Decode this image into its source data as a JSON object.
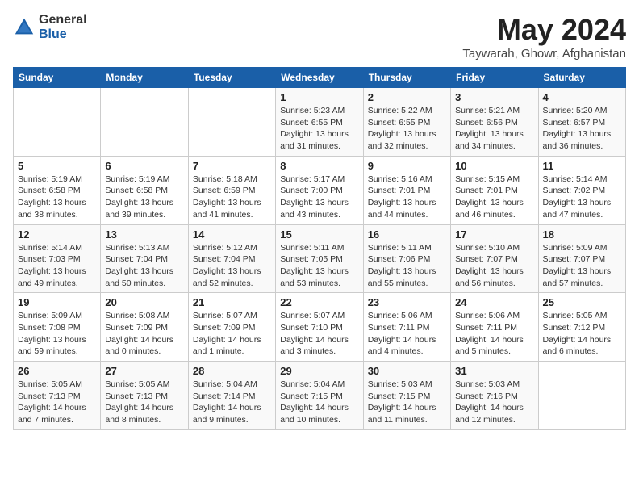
{
  "header": {
    "logo_general": "General",
    "logo_blue": "Blue",
    "month_year": "May 2024",
    "location": "Taywarah, Ghowr, Afghanistan"
  },
  "days_of_week": [
    "Sunday",
    "Monday",
    "Tuesday",
    "Wednesday",
    "Thursday",
    "Friday",
    "Saturday"
  ],
  "weeks": [
    [
      {
        "day": "",
        "info": ""
      },
      {
        "day": "",
        "info": ""
      },
      {
        "day": "",
        "info": ""
      },
      {
        "day": "1",
        "info": "Sunrise: 5:23 AM\nSunset: 6:55 PM\nDaylight: 13 hours\nand 31 minutes."
      },
      {
        "day": "2",
        "info": "Sunrise: 5:22 AM\nSunset: 6:55 PM\nDaylight: 13 hours\nand 32 minutes."
      },
      {
        "day": "3",
        "info": "Sunrise: 5:21 AM\nSunset: 6:56 PM\nDaylight: 13 hours\nand 34 minutes."
      },
      {
        "day": "4",
        "info": "Sunrise: 5:20 AM\nSunset: 6:57 PM\nDaylight: 13 hours\nand 36 minutes."
      }
    ],
    [
      {
        "day": "5",
        "info": "Sunrise: 5:19 AM\nSunset: 6:58 PM\nDaylight: 13 hours\nand 38 minutes."
      },
      {
        "day": "6",
        "info": "Sunrise: 5:19 AM\nSunset: 6:58 PM\nDaylight: 13 hours\nand 39 minutes."
      },
      {
        "day": "7",
        "info": "Sunrise: 5:18 AM\nSunset: 6:59 PM\nDaylight: 13 hours\nand 41 minutes."
      },
      {
        "day": "8",
        "info": "Sunrise: 5:17 AM\nSunset: 7:00 PM\nDaylight: 13 hours\nand 43 minutes."
      },
      {
        "day": "9",
        "info": "Sunrise: 5:16 AM\nSunset: 7:01 PM\nDaylight: 13 hours\nand 44 minutes."
      },
      {
        "day": "10",
        "info": "Sunrise: 5:15 AM\nSunset: 7:01 PM\nDaylight: 13 hours\nand 46 minutes."
      },
      {
        "day": "11",
        "info": "Sunrise: 5:14 AM\nSunset: 7:02 PM\nDaylight: 13 hours\nand 47 minutes."
      }
    ],
    [
      {
        "day": "12",
        "info": "Sunrise: 5:14 AM\nSunset: 7:03 PM\nDaylight: 13 hours\nand 49 minutes."
      },
      {
        "day": "13",
        "info": "Sunrise: 5:13 AM\nSunset: 7:04 PM\nDaylight: 13 hours\nand 50 minutes."
      },
      {
        "day": "14",
        "info": "Sunrise: 5:12 AM\nSunset: 7:04 PM\nDaylight: 13 hours\nand 52 minutes."
      },
      {
        "day": "15",
        "info": "Sunrise: 5:11 AM\nSunset: 7:05 PM\nDaylight: 13 hours\nand 53 minutes."
      },
      {
        "day": "16",
        "info": "Sunrise: 5:11 AM\nSunset: 7:06 PM\nDaylight: 13 hours\nand 55 minutes."
      },
      {
        "day": "17",
        "info": "Sunrise: 5:10 AM\nSunset: 7:07 PM\nDaylight: 13 hours\nand 56 minutes."
      },
      {
        "day": "18",
        "info": "Sunrise: 5:09 AM\nSunset: 7:07 PM\nDaylight: 13 hours\nand 57 minutes."
      }
    ],
    [
      {
        "day": "19",
        "info": "Sunrise: 5:09 AM\nSunset: 7:08 PM\nDaylight: 13 hours\nand 59 minutes."
      },
      {
        "day": "20",
        "info": "Sunrise: 5:08 AM\nSunset: 7:09 PM\nDaylight: 14 hours\nand 0 minutes."
      },
      {
        "day": "21",
        "info": "Sunrise: 5:07 AM\nSunset: 7:09 PM\nDaylight: 14 hours\nand 1 minute."
      },
      {
        "day": "22",
        "info": "Sunrise: 5:07 AM\nSunset: 7:10 PM\nDaylight: 14 hours\nand 3 minutes."
      },
      {
        "day": "23",
        "info": "Sunrise: 5:06 AM\nSunset: 7:11 PM\nDaylight: 14 hours\nand 4 minutes."
      },
      {
        "day": "24",
        "info": "Sunrise: 5:06 AM\nSunset: 7:11 PM\nDaylight: 14 hours\nand 5 minutes."
      },
      {
        "day": "25",
        "info": "Sunrise: 5:05 AM\nSunset: 7:12 PM\nDaylight: 14 hours\nand 6 minutes."
      }
    ],
    [
      {
        "day": "26",
        "info": "Sunrise: 5:05 AM\nSunset: 7:13 PM\nDaylight: 14 hours\nand 7 minutes."
      },
      {
        "day": "27",
        "info": "Sunrise: 5:05 AM\nSunset: 7:13 PM\nDaylight: 14 hours\nand 8 minutes."
      },
      {
        "day": "28",
        "info": "Sunrise: 5:04 AM\nSunset: 7:14 PM\nDaylight: 14 hours\nand 9 minutes."
      },
      {
        "day": "29",
        "info": "Sunrise: 5:04 AM\nSunset: 7:15 PM\nDaylight: 14 hours\nand 10 minutes."
      },
      {
        "day": "30",
        "info": "Sunrise: 5:03 AM\nSunset: 7:15 PM\nDaylight: 14 hours\nand 11 minutes."
      },
      {
        "day": "31",
        "info": "Sunrise: 5:03 AM\nSunset: 7:16 PM\nDaylight: 14 hours\nand 12 minutes."
      },
      {
        "day": "",
        "info": ""
      }
    ]
  ]
}
